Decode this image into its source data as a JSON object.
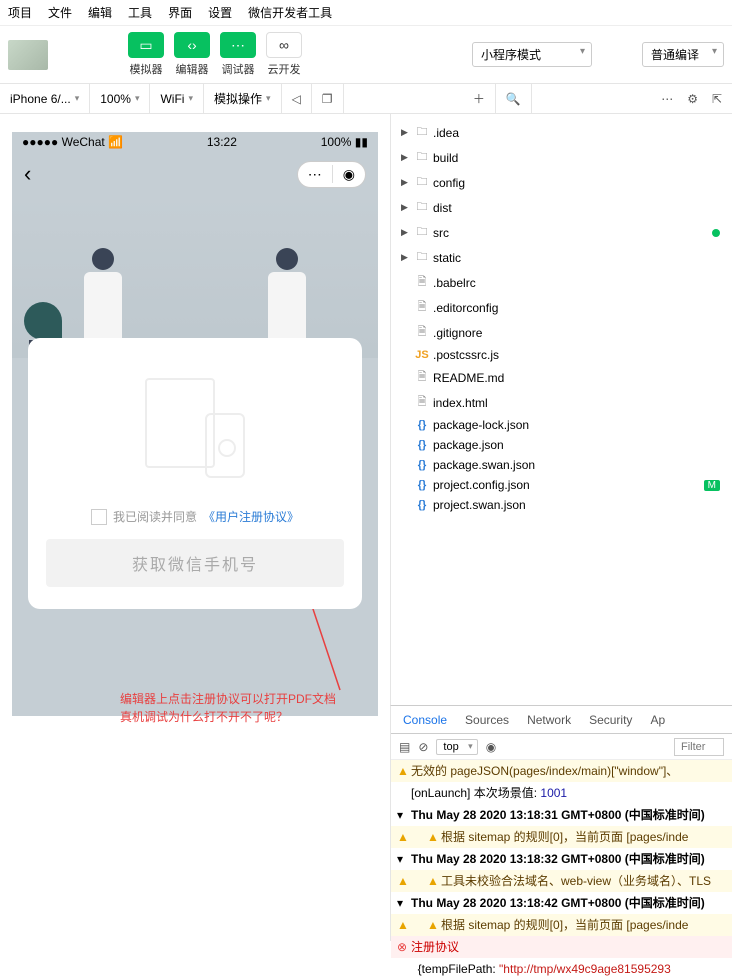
{
  "menu": [
    "项目",
    "文件",
    "编辑",
    "工具",
    "界面",
    "设置",
    "微信开发者工具"
  ],
  "toolbar": {
    "sim": "模拟器",
    "editor": "编辑器",
    "debugger": "调试器",
    "cloud": "云开发",
    "mode": "小程序模式",
    "compile": "普通编译"
  },
  "simbar": {
    "device": "iPhone 6/...",
    "zoom": "100%",
    "net": "WiFi",
    "mock": "模拟操作"
  },
  "phone": {
    "carrier": "WeChat",
    "time": "13:22",
    "battery": "100%",
    "agree_prefix": "我已阅读并同意",
    "agree_link": "《用户注册协议》",
    "get_phone": "获取微信手机号"
  },
  "annotation": {
    "l1": "编辑器上点击注册协议可以打开PDF文档",
    "l2": "真机调试为什么打不开不了呢？"
  },
  "tree": [
    {
      "d": 0,
      "t": "folder",
      "n": ".idea",
      "exp": false
    },
    {
      "d": 0,
      "t": "folder",
      "n": "build",
      "exp": false
    },
    {
      "d": 0,
      "t": "folder",
      "n": "config",
      "exp": false
    },
    {
      "d": 0,
      "t": "folder",
      "n": "dist",
      "exp": false
    },
    {
      "d": 0,
      "t": "folder",
      "n": "src",
      "exp": false,
      "dot": true
    },
    {
      "d": 0,
      "t": "folder",
      "n": "static",
      "exp": false
    },
    {
      "d": 0,
      "t": "file",
      "n": ".babelrc"
    },
    {
      "d": 0,
      "t": "file",
      "n": ".editorconfig"
    },
    {
      "d": 0,
      "t": "file",
      "n": ".gitignore"
    },
    {
      "d": 0,
      "t": "js",
      "n": ".postcssrc.js"
    },
    {
      "d": 0,
      "t": "file",
      "n": "README.md"
    },
    {
      "d": 0,
      "t": "file",
      "n": "index.html"
    },
    {
      "d": 0,
      "t": "json",
      "n": "package-lock.json"
    },
    {
      "d": 0,
      "t": "json",
      "n": "package.json"
    },
    {
      "d": 0,
      "t": "json",
      "n": "package.swan.json"
    },
    {
      "d": 0,
      "t": "json",
      "n": "project.config.json",
      "m": true
    },
    {
      "d": 0,
      "t": "json",
      "n": "project.swan.json"
    }
  ],
  "devtabs": [
    "Console",
    "Sources",
    "Network",
    "Security",
    "Ap"
  ],
  "ctx": "top",
  "filter_ph": "Filter",
  "logs": [
    {
      "lv": "warn",
      "tw": "▸",
      "txt": "无效的 pageJSON(pages/index/main)[\"window\"]、"
    },
    {
      "lv": "plain",
      "txt": "[onLaunch] 本次场景值: ",
      "num": "1001"
    },
    {
      "lv": "plain",
      "tw": "▾",
      "txt": "Thu May 28 2020 13:18:31 GMT+0800 (中国标准时间)",
      "b": true
    },
    {
      "lv": "warn",
      "tw": "▸",
      "txt": "根据 sitemap 的规则[0]，当前页面 [pages/inde",
      "ind": 1
    },
    {
      "lv": "plain",
      "tw": "▾",
      "txt": "Thu May 28 2020 13:18:32 GMT+0800 (中国标准时间)",
      "b": true
    },
    {
      "lv": "warn",
      "tw": "▸",
      "txt": "工具未校验合法域名、web-view（业务域名）、TLS",
      "ind": 1
    },
    {
      "lv": "plain",
      "tw": "▾",
      "txt": "Thu May 28 2020 13:18:42 GMT+0800 (中国标准时间)",
      "b": true
    },
    {
      "lv": "warn",
      "tw": "▸",
      "txt": "根据 sitemap 的规则[0]，当前页面 [pages/inde",
      "ind": 1
    },
    {
      "lv": "err",
      "txt": "注册协议"
    },
    {
      "lv": "plain",
      "txt": "  {tempFilePath: ",
      "url": "\"http://tmp/wx49c9age81595293"
    }
  ]
}
